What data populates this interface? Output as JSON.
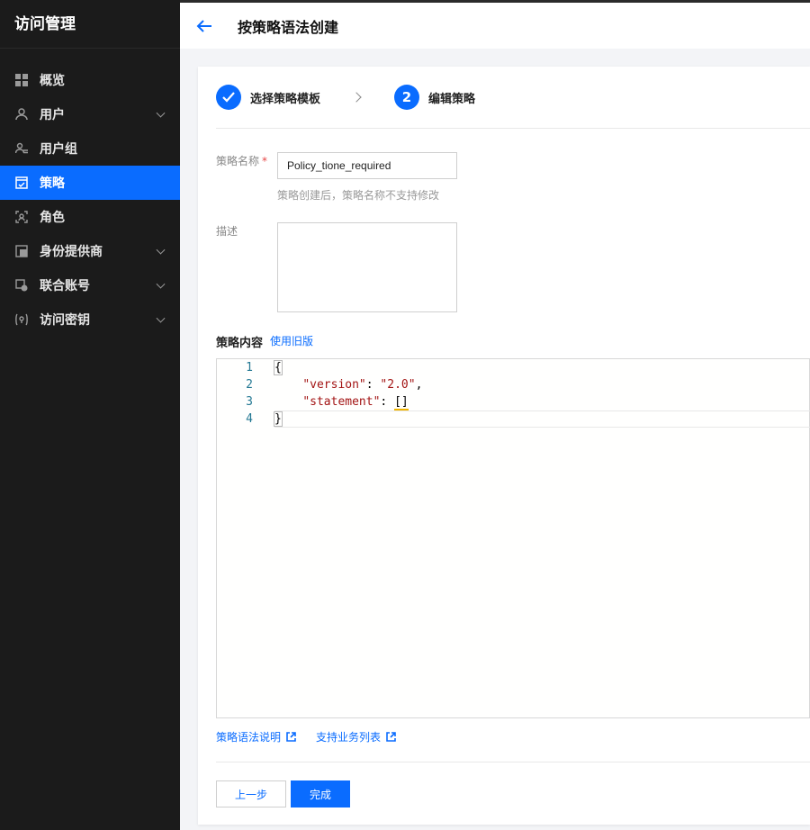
{
  "app": {
    "title": "访问管理"
  },
  "sidebar": {
    "items": [
      {
        "label": "概览",
        "icon": "grid-icon",
        "expandable": false,
        "active": false
      },
      {
        "label": "用户",
        "icon": "user-icon",
        "expandable": true,
        "active": false
      },
      {
        "label": "用户组",
        "icon": "user-group-icon",
        "expandable": false,
        "active": false
      },
      {
        "label": "策略",
        "icon": "policy-icon",
        "expandable": false,
        "active": true
      },
      {
        "label": "角色",
        "icon": "role-icon",
        "expandable": false,
        "active": false
      },
      {
        "label": "身份提供商",
        "icon": "identity-provider-icon",
        "expandable": true,
        "active": false
      },
      {
        "label": "联合账号",
        "icon": "federated-account-icon",
        "expandable": true,
        "active": false
      },
      {
        "label": "访问密钥",
        "icon": "access-key-icon",
        "expandable": true,
        "active": false
      }
    ]
  },
  "header": {
    "title": "按策略语法创建"
  },
  "steps": [
    {
      "label": "选择策略模板",
      "state": "done"
    },
    {
      "number": "2",
      "label": "编辑策略",
      "state": "current"
    }
  ],
  "form": {
    "name_label": "策略名称",
    "required_mark": "*",
    "name_value": "Policy_tione_required",
    "name_hint": "策略创建后，策略名称不支持修改",
    "desc_label": "描述",
    "desc_value": ""
  },
  "policy_content": {
    "title": "策略内容",
    "old_version_link": "使用旧版",
    "line_numbers": [
      "1",
      "2",
      "3",
      "4"
    ],
    "lines": {
      "l1": "{",
      "l2_key": "\"version\"",
      "l2_sep": ": ",
      "l2_val": "\"2.0\"",
      "l2_end": ",",
      "l3_key": "\"statement\"",
      "l3_sep": ": ",
      "l3_val": "[]",
      "l4": "}"
    }
  },
  "links": {
    "syntax": "策略语法说明",
    "services": "支持业务列表"
  },
  "buttons": {
    "prev": "上一步",
    "done": "完成"
  },
  "colors": {
    "accent": "#0a6cff",
    "sidebar_bg": "#1b1b1b",
    "required": "#e54545"
  }
}
